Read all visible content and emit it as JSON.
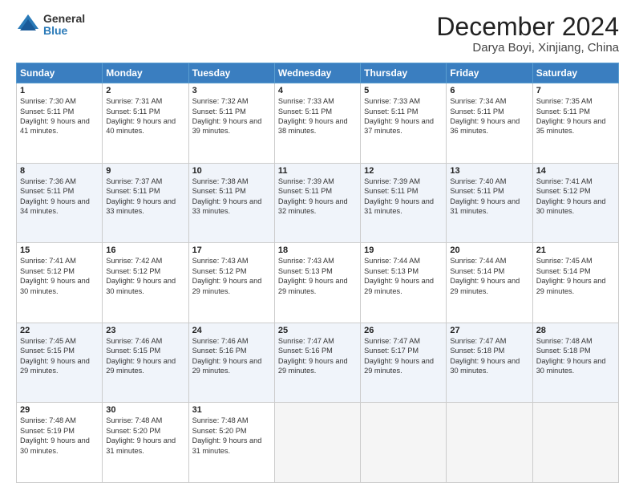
{
  "header": {
    "logo_general": "General",
    "logo_blue": "Blue",
    "month_title": "December 2024",
    "location": "Darya Boyi, Xinjiang, China"
  },
  "days_of_week": [
    "Sunday",
    "Monday",
    "Tuesday",
    "Wednesday",
    "Thursday",
    "Friday",
    "Saturday"
  ],
  "weeks": [
    [
      {
        "day": 1,
        "sunrise": "Sunrise: 7:30 AM",
        "sunset": "Sunset: 5:11 PM",
        "daylight": "Daylight: 9 hours and 41 minutes."
      },
      {
        "day": 2,
        "sunrise": "Sunrise: 7:31 AM",
        "sunset": "Sunset: 5:11 PM",
        "daylight": "Daylight: 9 hours and 40 minutes."
      },
      {
        "day": 3,
        "sunrise": "Sunrise: 7:32 AM",
        "sunset": "Sunset: 5:11 PM",
        "daylight": "Daylight: 9 hours and 39 minutes."
      },
      {
        "day": 4,
        "sunrise": "Sunrise: 7:33 AM",
        "sunset": "Sunset: 5:11 PM",
        "daylight": "Daylight: 9 hours and 38 minutes."
      },
      {
        "day": 5,
        "sunrise": "Sunrise: 7:33 AM",
        "sunset": "Sunset: 5:11 PM",
        "daylight": "Daylight: 9 hours and 37 minutes."
      },
      {
        "day": 6,
        "sunrise": "Sunrise: 7:34 AM",
        "sunset": "Sunset: 5:11 PM",
        "daylight": "Daylight: 9 hours and 36 minutes."
      },
      {
        "day": 7,
        "sunrise": "Sunrise: 7:35 AM",
        "sunset": "Sunset: 5:11 PM",
        "daylight": "Daylight: 9 hours and 35 minutes."
      }
    ],
    [
      {
        "day": 8,
        "sunrise": "Sunrise: 7:36 AM",
        "sunset": "Sunset: 5:11 PM",
        "daylight": "Daylight: 9 hours and 34 minutes."
      },
      {
        "day": 9,
        "sunrise": "Sunrise: 7:37 AM",
        "sunset": "Sunset: 5:11 PM",
        "daylight": "Daylight: 9 hours and 33 minutes."
      },
      {
        "day": 10,
        "sunrise": "Sunrise: 7:38 AM",
        "sunset": "Sunset: 5:11 PM",
        "daylight": "Daylight: 9 hours and 33 minutes."
      },
      {
        "day": 11,
        "sunrise": "Sunrise: 7:39 AM",
        "sunset": "Sunset: 5:11 PM",
        "daylight": "Daylight: 9 hours and 32 minutes."
      },
      {
        "day": 12,
        "sunrise": "Sunrise: 7:39 AM",
        "sunset": "Sunset: 5:11 PM",
        "daylight": "Daylight: 9 hours and 31 minutes."
      },
      {
        "day": 13,
        "sunrise": "Sunrise: 7:40 AM",
        "sunset": "Sunset: 5:11 PM",
        "daylight": "Daylight: 9 hours and 31 minutes."
      },
      {
        "day": 14,
        "sunrise": "Sunrise: 7:41 AM",
        "sunset": "Sunset: 5:12 PM",
        "daylight": "Daylight: 9 hours and 30 minutes."
      }
    ],
    [
      {
        "day": 15,
        "sunrise": "Sunrise: 7:41 AM",
        "sunset": "Sunset: 5:12 PM",
        "daylight": "Daylight: 9 hours and 30 minutes."
      },
      {
        "day": 16,
        "sunrise": "Sunrise: 7:42 AM",
        "sunset": "Sunset: 5:12 PM",
        "daylight": "Daylight: 9 hours and 30 minutes."
      },
      {
        "day": 17,
        "sunrise": "Sunrise: 7:43 AM",
        "sunset": "Sunset: 5:12 PM",
        "daylight": "Daylight: 9 hours and 29 minutes."
      },
      {
        "day": 18,
        "sunrise": "Sunrise: 7:43 AM",
        "sunset": "Sunset: 5:13 PM",
        "daylight": "Daylight: 9 hours and 29 minutes."
      },
      {
        "day": 19,
        "sunrise": "Sunrise: 7:44 AM",
        "sunset": "Sunset: 5:13 PM",
        "daylight": "Daylight: 9 hours and 29 minutes."
      },
      {
        "day": 20,
        "sunrise": "Sunrise: 7:44 AM",
        "sunset": "Sunset: 5:14 PM",
        "daylight": "Daylight: 9 hours and 29 minutes."
      },
      {
        "day": 21,
        "sunrise": "Sunrise: 7:45 AM",
        "sunset": "Sunset: 5:14 PM",
        "daylight": "Daylight: 9 hours and 29 minutes."
      }
    ],
    [
      {
        "day": 22,
        "sunrise": "Sunrise: 7:45 AM",
        "sunset": "Sunset: 5:15 PM",
        "daylight": "Daylight: 9 hours and 29 minutes."
      },
      {
        "day": 23,
        "sunrise": "Sunrise: 7:46 AM",
        "sunset": "Sunset: 5:15 PM",
        "daylight": "Daylight: 9 hours and 29 minutes."
      },
      {
        "day": 24,
        "sunrise": "Sunrise: 7:46 AM",
        "sunset": "Sunset: 5:16 PM",
        "daylight": "Daylight: 9 hours and 29 minutes."
      },
      {
        "day": 25,
        "sunrise": "Sunrise: 7:47 AM",
        "sunset": "Sunset: 5:16 PM",
        "daylight": "Daylight: 9 hours and 29 minutes."
      },
      {
        "day": 26,
        "sunrise": "Sunrise: 7:47 AM",
        "sunset": "Sunset: 5:17 PM",
        "daylight": "Daylight: 9 hours and 29 minutes."
      },
      {
        "day": 27,
        "sunrise": "Sunrise: 7:47 AM",
        "sunset": "Sunset: 5:18 PM",
        "daylight": "Daylight: 9 hours and 30 minutes."
      },
      {
        "day": 28,
        "sunrise": "Sunrise: 7:48 AM",
        "sunset": "Sunset: 5:18 PM",
        "daylight": "Daylight: 9 hours and 30 minutes."
      }
    ],
    [
      {
        "day": 29,
        "sunrise": "Sunrise: 7:48 AM",
        "sunset": "Sunset: 5:19 PM",
        "daylight": "Daylight: 9 hours and 30 minutes."
      },
      {
        "day": 30,
        "sunrise": "Sunrise: 7:48 AM",
        "sunset": "Sunset: 5:20 PM",
        "daylight": "Daylight: 9 hours and 31 minutes."
      },
      {
        "day": 31,
        "sunrise": "Sunrise: 7:48 AM",
        "sunset": "Sunset: 5:20 PM",
        "daylight": "Daylight: 9 hours and 31 minutes."
      },
      null,
      null,
      null,
      null
    ]
  ]
}
